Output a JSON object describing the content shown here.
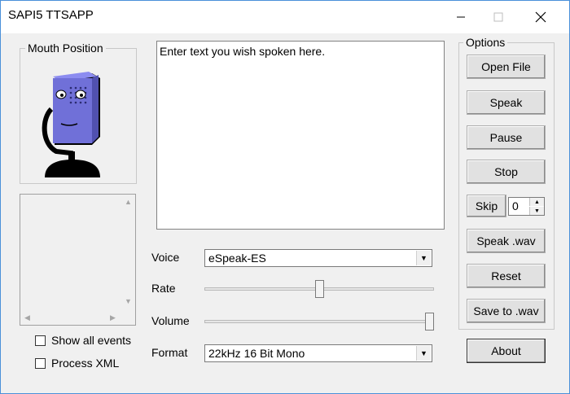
{
  "window": {
    "title": "SAPI5 TTSAPP"
  },
  "mouth_group": {
    "label": "Mouth Position"
  },
  "text_area": {
    "placeholder_text": "Enter text you wish spoken here."
  },
  "voice": {
    "label": "Voice",
    "value": "eSpeak-ES"
  },
  "rate": {
    "label": "Rate",
    "level": 0.5
  },
  "volume": {
    "label": "Volume",
    "level": 1.0
  },
  "format": {
    "label": "Format",
    "value": "22kHz 16 Bit Mono"
  },
  "checkboxes": {
    "show_all_events": "Show all events",
    "process_xml": "Process XML"
  },
  "options": {
    "label": "Options",
    "open_file": "Open File",
    "speak": "Speak",
    "pause": "Pause",
    "stop": "Stop",
    "skip": "Skip",
    "skip_value": "0",
    "speak_wav": "Speak .wav",
    "reset": "Reset",
    "save_wav": "Save to .wav"
  },
  "about": "About",
  "colors": {
    "microphone": "#7070d8",
    "border_accent": "#4a90d9"
  },
  "icons": {
    "minimize": "minimize-icon",
    "maximize": "maximize-icon",
    "close": "close-icon"
  }
}
